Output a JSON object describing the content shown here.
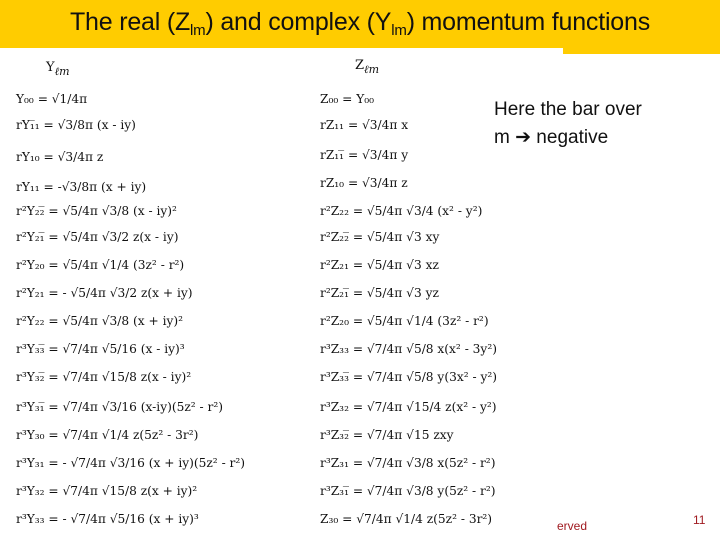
{
  "slide": {
    "title_parts": [
      "The real (Z",
      "lm",
      ") and complex (Y",
      "lm",
      ") momentum functions"
    ],
    "note_line1": "Here the bar over",
    "note_line2": "m ➔ negative",
    "footer_text": "erved",
    "page_number": "11",
    "accent_color": "#ffcc00",
    "footer_color": "#a01a20"
  },
  "left_column": {
    "header": "Y",
    "header_sub": "ℓm",
    "equations": [
      "Y₀₀ = √1/4π",
      "rY₁̅₁ = √3/8π  (x - iy)",
      "rY₁₀ = √3/4π   z",
      "rY₁₁ = -√3/8π  (x + iy)",
      "r²Y₂₂̅ = √5/4π √3/8  (x - iy)²",
      "r²Y₂₁̅ = √5/4π √3/2  z(x - iy)",
      "r²Y₂₀ = √5/4π √1/4  (3z² - r²)",
      "r²Y₂₁ = - √5/4π √3/2  z(x + iy)",
      "r²Y₂₂ = √5/4π √3/8  (x + iy)²",
      "r³Y₃₃̅ = √7/4π √5/16  (x - iy)³",
      "r³Y₃₂̅ = √7/4π √15/8  z(x - iy)²",
      "r³Y₃₁̅ = √7/4π √3/16  (x-iy)(5z² - r²)",
      "r³Y₃₀ = √7/4π √1/4  z(5z² - 3r²)",
      "r³Y₃₁ = - √7/4π √3/16  (x + iy)(5z² - r²)",
      "r³Y₃₂ = √7/4π √15/8  z(x + iy)²",
      "r³Y₃₃ = - √7/4π √5/16  (x + iy)³"
    ]
  },
  "right_column": {
    "header": "Z",
    "header_sub": "ℓm",
    "equations": [
      "Z₀₀ = Y₀₀",
      "rZ₁₁ = √3/4π  x",
      "rZ₁₁̅ = √3/4π  y",
      "rZ₁₀ = √3/4π  z",
      "r²Z₂₂ = √5/4π √3/4  (x² - y²)",
      "r²Z₂₂̅ = √5/4π √3  xy",
      "r²Z₂₁ = √5/4π √3  xz",
      "r²Z₂₁̅ = √5/4π √3  yz",
      "r²Z₂₀ = √5/4π √1/4  (3z² - r²)",
      "r³Z₃₃ = √7/4π √5/8  x(x² - 3y²)",
      "r³Z₃₃̅ = √7/4π √5/8  y(3x² - y²)",
      "r³Z₃₂ = √7/4π √15/4  z(x² - y²)",
      "r³Z₃₂̅ = √7/4π √15  zxy",
      "r³Z₃₁ = √7/4π √3/8  x(5z² - r²)",
      "r³Z₃₁̅ = √7/4π √3/8  y(5z² - r²)",
      "Z₃₀ = √7/4π √1/4  z(5z² - 3r²)"
    ]
  }
}
